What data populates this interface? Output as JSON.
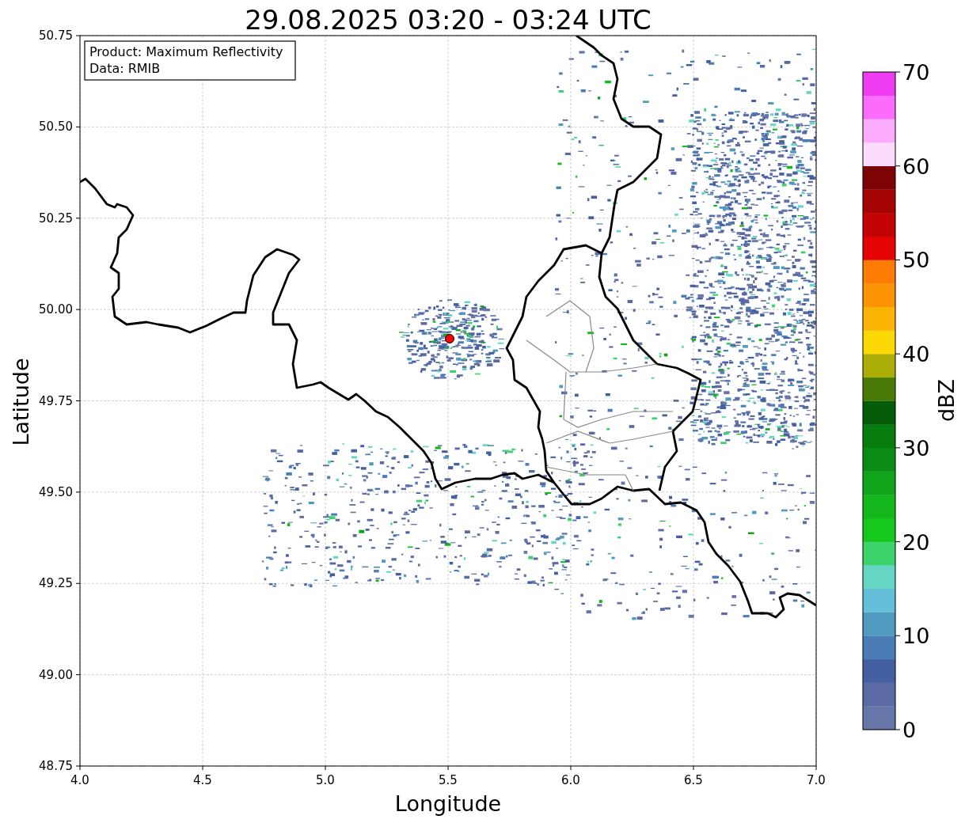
{
  "title": "29.08.2025 03:20 - 03:24 UTC",
  "info_box": [
    "Product: Maximum Reflectivity",
    "Data: RMIB"
  ],
  "x_axis": {
    "label": "Longitude",
    "ticks": [
      "4.0",
      "4.5",
      "5.0",
      "5.5",
      "6.0",
      "6.5",
      "7.0"
    ]
  },
  "y_axis": {
    "label": "Latitude",
    "ticks": [
      "50.75",
      "50.50",
      "50.25",
      "50.00",
      "49.75",
      "49.50",
      "49.25",
      "49.00",
      "48.75"
    ]
  },
  "colorbar": {
    "label": "dBZ",
    "ticks": [
      "70",
      "60",
      "50",
      "40",
      "30",
      "20",
      "10",
      "0"
    ],
    "segments": [
      {
        "color": "#6776a8"
      },
      {
        "color": "#5b6aa3"
      },
      {
        "color": "#4460a3"
      },
      {
        "color": "#4a7db5"
      },
      {
        "color": "#509ac0"
      },
      {
        "color": "#63bfd8"
      },
      {
        "color": "#66d6c4"
      },
      {
        "color": "#3cd26c"
      },
      {
        "color": "#14c81c"
      },
      {
        "color": "#14b81c"
      },
      {
        "color": "#0fa41a"
      },
      {
        "color": "#0a8c14"
      },
      {
        "color": "#067b0e"
      },
      {
        "color": "#045c08"
      },
      {
        "color": "#4a7a06"
      },
      {
        "color": "#acae08"
      },
      {
        "color": "#fcd804"
      },
      {
        "color": "#fcb404"
      },
      {
        "color": "#fc9404"
      },
      {
        "color": "#fc7c04"
      },
      {
        "color": "#e40404"
      },
      {
        "color": "#c40404"
      },
      {
        "color": "#a40404"
      },
      {
        "color": "#7c0404"
      },
      {
        "color": "#fcdcfc"
      },
      {
        "color": "#fcacfc"
      },
      {
        "color": "#fc6cfc"
      },
      {
        "color": "#f03cf0"
      }
    ]
  }
}
